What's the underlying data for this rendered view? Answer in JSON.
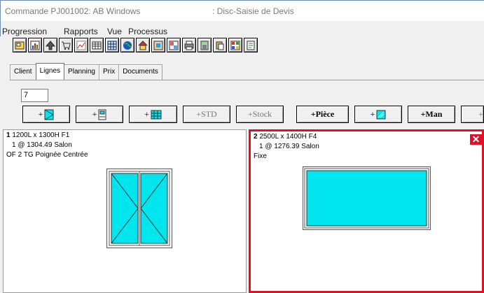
{
  "window": {
    "title": "Commande PJ001002: AB Windows",
    "subtitle": ": Disc-Saisie de Devis"
  },
  "menu": [
    "Progression",
    "Rapports",
    "Vue",
    "Processus"
  ],
  "toolbar_icons": [
    "open-icon",
    "chart-icon",
    "up-arrow-icon",
    "cart-icon",
    "line-chart-icon",
    "table-icon",
    "grid-icon",
    "globe-icon",
    "house-icon",
    "frame-icon",
    "gallery-icon",
    "print-icon",
    "calculator-icon",
    "paste-icon",
    "palette-icon",
    "sheet-icon"
  ],
  "tabs": [
    "Client",
    "Lignes",
    "Planning",
    "Prix",
    "Documents"
  ],
  "active_tab": "Lignes",
  "quantity": "7",
  "add_buttons": {
    "b1": "+",
    "b2": "+",
    "b3": "+",
    "std": "+STD",
    "stock": "+Stock",
    "piece": "+Pièce",
    "b7": "+",
    "man": "+Man",
    "b9": "+"
  },
  "items": [
    {
      "num": "1",
      "dims": "1200L x 1300H  F1",
      "line2": "1 @ 1304.49  Salon",
      "line3": "OF 2 TG Poignée Centrée"
    },
    {
      "num": "2",
      "dims": "2500L x 1400H  F4",
      "line2": "1 @ 1276.39  Salon",
      "line3": "Fixe"
    }
  ],
  "colors": {
    "glass": "#00e5ee",
    "selected_border": "#e0102a",
    "close": "#e0102a"
  }
}
